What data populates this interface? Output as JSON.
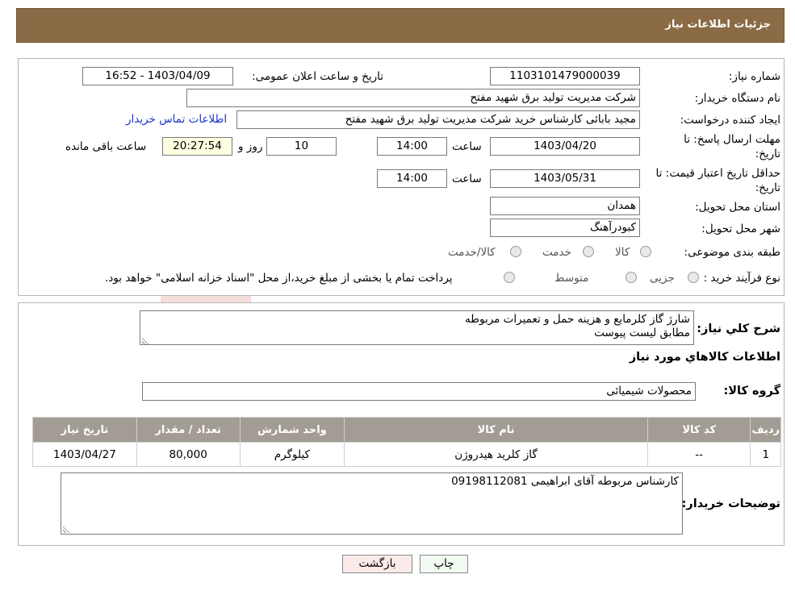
{
  "header": {
    "title": "جزئیات اطلاعات نیاز"
  },
  "need": {
    "number_label": "شماره نیاز:",
    "number_value": "1103101479000039",
    "announce_label": "تاریخ و ساعت اعلان عمومی:",
    "announce_value": "1403/04/09 - 16:52",
    "buyer_label": "نام دستگاه خریدار:",
    "buyer_value": "شرکت مدیریت تولید برق شهید مفتح",
    "creator_label": "ایجاد کننده درخواست:",
    "creator_value": "مجید بابائی کارشناس خرید شرکت مدیریت تولید برق شهید مفتح",
    "contact_link": "اطلاعات تماس خریدار",
    "deadline_label_1": "مهلت ارسال پاسخ: تا",
    "deadline_label_2": "تاریخ:",
    "deadline_date": "1403/04/20",
    "time_label": "ساعت",
    "deadline_time": "14:00",
    "days_value": "10",
    "days_label": "روز و",
    "remaining_value": "20:27:54",
    "remaining_label": "ساعت باقی مانده",
    "validity_label_1": "حداقل تاریخ اعتبار قیمت: تا",
    "validity_label_2": "تاریخ:",
    "validity_date": "1403/05/31",
    "validity_time": "14:00",
    "province_label": "استان محل تحویل:",
    "province_value": "همدان",
    "city_label": "شهر محل تحویل:",
    "city_value": "کبودرآهنگ",
    "category_label": "طبقه بندی موضوعی:",
    "category_options": [
      "کالا",
      "خدمت",
      "کالا/خدمت"
    ],
    "process_label": "نوع فرآیند خرید :",
    "process_options": [
      "جزیی",
      "متوسط"
    ],
    "process_note": "پرداخت تمام یا بخشی از مبلغ خرید،از محل \"اسناد خزانه اسلامی\" خواهد بود."
  },
  "summary": {
    "label": "شرح کلي نياز:",
    "text": "شارژ گاز کلرمایع  و هزینه حمل و تعمیرات مربوطه\nمطابق لیست پیوست"
  },
  "goods": {
    "section_title": "اطلاعات کالاهاي مورد نياز",
    "group_label": "گروه کالا:",
    "group_value": "محصولات شیمیائی",
    "columns": [
      "رديف",
      "کد کالا",
      "نام کالا",
      "واحد شمارش",
      "تعداد / مقدار",
      "تاريخ نياز"
    ],
    "rows": [
      [
        "1",
        "--",
        "گاز کلرید هیدروژن",
        "کیلوگرم",
        "80,000",
        "1403/04/27"
      ]
    ]
  },
  "buyer_notes": {
    "label": "توضیحات خریدار:",
    "text": "کارشناس مربوطه آقای ابراهیمی 09198112081"
  },
  "buttons": {
    "print": "چاپ",
    "back": "بازگشت"
  },
  "colors": {
    "header": "#8b6b45",
    "table_header": "#a39c95",
    "link": "#1a32c8"
  }
}
